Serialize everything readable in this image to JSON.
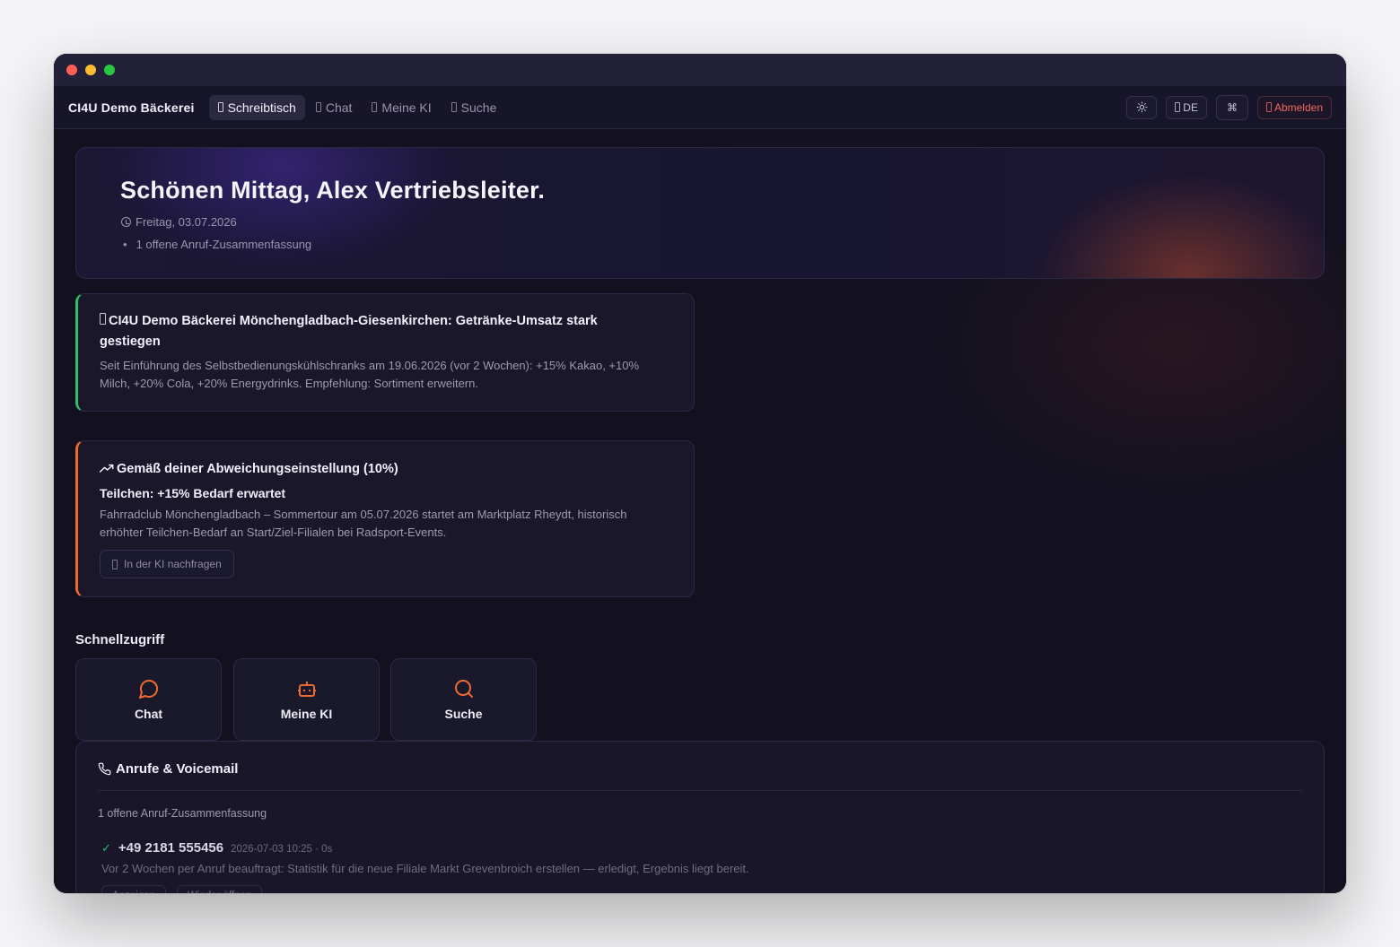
{
  "nav": {
    "brand": "CI4U Demo Bäckerei",
    "tabs": [
      {
        "label": "Schreibtisch",
        "active": true
      },
      {
        "label": "Chat",
        "active": false
      },
      {
        "label": "Meine KI",
        "active": false
      },
      {
        "label": "Suche",
        "active": false
      }
    ],
    "theme_icon": "sun-icon",
    "language_label": "DE",
    "command_glyph": "⌘",
    "logout_label": "Abmelden"
  },
  "hero": {
    "greeting": "Schönen Mittag, Alex Vertriebsleiter.",
    "date": "Freitag, 03.07.2026",
    "bullet": "1 offene Anruf-Zusammenfassung"
  },
  "insights": [
    {
      "title": "CI4U Demo Bäckerei Mönchengladbach-Giesenkirchen: Getränke-Umsatz stark gestiegen",
      "body": "Seit Einführung des Selbstbedienungskühlschranks am 19.06.2026 (vor 2 Wochen): +15% Kakao, +10% Milch, +20% Cola, +20% Energydrinks. Empfehlung: Sortiment erweitern.",
      "accent": "#2fbe6a"
    },
    {
      "title": "Gemäß deiner Abweichungseinstellung (10%)",
      "subtitle": "Teilchen: +15% Bedarf erwartet",
      "body": "Fahrradclub Mönchengladbach – Sommertour am 05.07.2026 startet am Marktplatz Rheydt, historisch erhöhter Teilchen-Bedarf an Start/Ziel-Filialen bei Radsport-Events.",
      "action_label": "In der KI nachfragen",
      "accent": "#ee6b2f"
    }
  ],
  "quick_access": {
    "heading": "Schnellzugriff",
    "items": [
      {
        "label": "Chat",
        "icon": "chat-bubble-icon"
      },
      {
        "label": "Meine KI",
        "icon": "robot-icon"
      },
      {
        "label": "Suche",
        "icon": "search-icon"
      }
    ],
    "icon_color": "#ee6b2f"
  },
  "calls": {
    "title": "Anrufe & Voicemail",
    "count_text": "1 offene Anruf-Zusammenfassung",
    "entries": [
      {
        "number": "+49 2181 555456",
        "meta": "2026-07-03 10:25 · 0s",
        "note": "Vor 2 Wochen per Anruf beauftragt: Statistik für die neue Filiale Markt Grevenbroich erstellen — erledigt, Ergebnis liegt bereit.",
        "actions": [
          "Anzeigen",
          "Wieder öffnen"
        ]
      }
    ]
  }
}
